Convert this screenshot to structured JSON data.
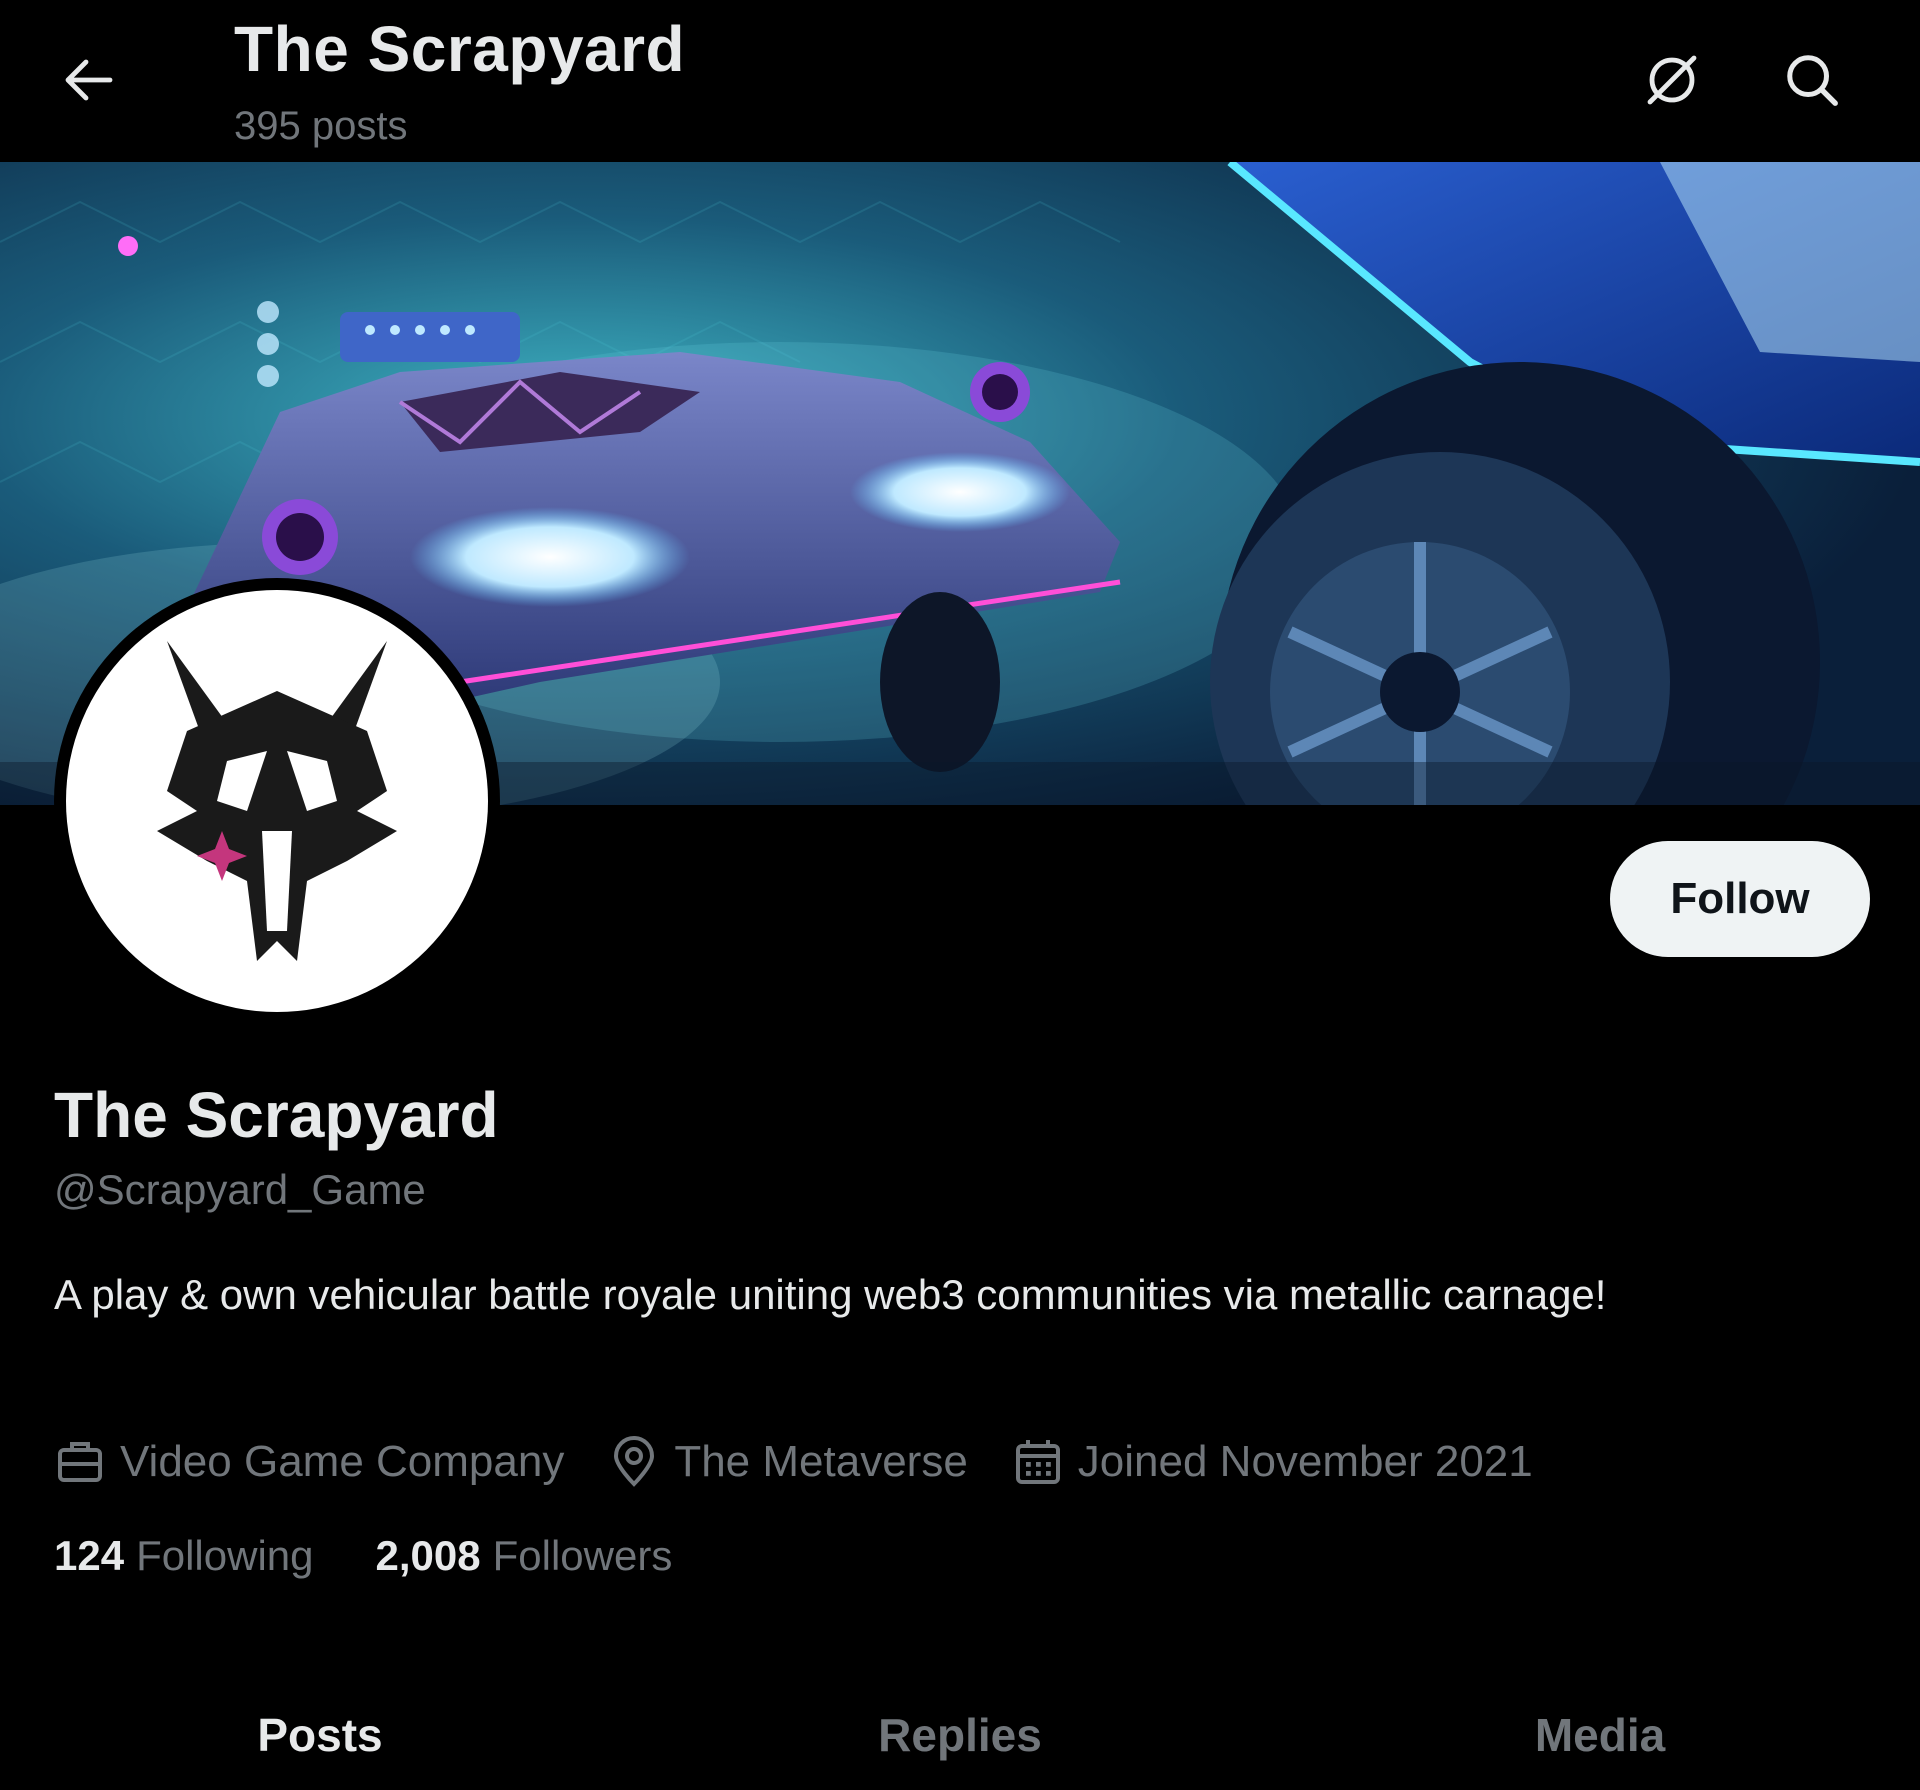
{
  "header": {
    "title": "The Scrapyard",
    "post_count": "395 posts"
  },
  "profile": {
    "display_name": "The Scrapyard",
    "handle": "@Scrapyard_Game",
    "bio": "A play & own vehicular battle royale uniting web3 communities via metallic carnage!",
    "category": "Video Game Company",
    "location": "The Metaverse",
    "joined": "Joined November 2021",
    "following_count": "124",
    "following_label": "Following",
    "followers_count": "2,008",
    "followers_label": "Followers",
    "follow_label": "Follow"
  },
  "tabs": [
    {
      "label": "Posts",
      "active": true
    },
    {
      "label": "Replies",
      "active": false
    },
    {
      "label": "Media",
      "active": false
    }
  ],
  "icons": {
    "back": "arrow-left-icon",
    "grok": "grok-icon",
    "search": "search-icon",
    "category": "briefcase-icon",
    "location": "location-pin-icon",
    "joined": "calendar-icon"
  },
  "colors": {
    "background": "#000000",
    "primary_text": "#e7e9ea",
    "secondary_text": "#71767b",
    "follow_button_bg": "#eff3f4",
    "follow_button_text": "#0f1419"
  }
}
